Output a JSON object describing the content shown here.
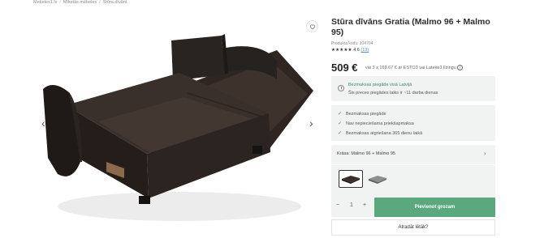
{
  "breadcrumb": [
    "Mebeles1.lv",
    "Mīkstās mēbeles",
    "Stūra dīvāni"
  ],
  "gallery": {
    "prev_glyph": "‹",
    "next_glyph": "›"
  },
  "product": {
    "title": "Stūra dīvāns Gratia (Malmo 96 + Malmo 95)",
    "code_line": "Produkta kods: 104704",
    "stars": "★★★★★",
    "rating": "4.6",
    "reviews": "(13)",
    "price": "509 €",
    "installment": "vai 3 x 169.67 € ar ESTO3 vai Lateko3 līzingu",
    "info_glyph": "i"
  },
  "delivery": {
    "line1": "Bezmaksas piegāde visā Latvijā",
    "line2": "Šis preces piegādes laiks ir ~11 darba dienas"
  },
  "benefits": [
    "Bezmaksas piegāde",
    "Nav nepieciešama priekšapmaksa",
    "Bezmaksas atgriešana 365 dienu laikā"
  ],
  "variant": {
    "label": "Krāsa: Malmo 96 + Malmo 95",
    "chevron": "›"
  },
  "cart": {
    "minus": "−",
    "qty": "1",
    "plus": "+",
    "add_label": "Pievienot grozam",
    "find_label": "Atradāt lētāk?"
  },
  "colors": {
    "accent": "#5aa87e",
    "delivery_text": "#3a8f68",
    "panel_bg": "#f1f3f2",
    "sofa": "#3a302b"
  }
}
